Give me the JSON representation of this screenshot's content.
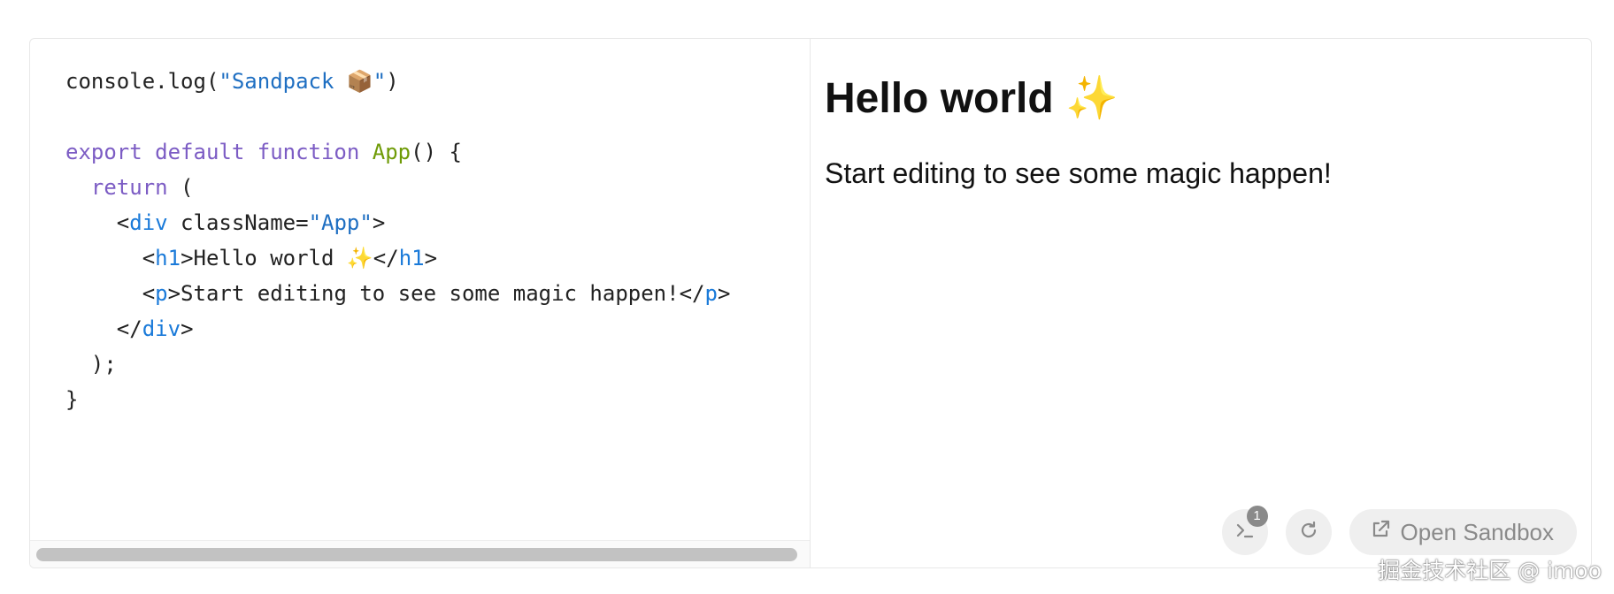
{
  "editor": {
    "lines": {
      "l1": {
        "a": "console.log(",
        "b": "\"Sandpack ",
        "emoji": "📦",
        "c": "\"",
        "d": ")"
      },
      "l3": {
        "a": "export default function ",
        "b": "App",
        "c": "() {"
      },
      "l4": {
        "a": "return",
        "b": " ("
      },
      "l5": {
        "a": "<",
        "b": "div",
        "c": " className=",
        "d": "\"App\"",
        "e": ">"
      },
      "l6": {
        "a": "<",
        "b": "h1",
        "c": ">Hello world ",
        "emoji": "✨",
        "d": "</",
        "e": "h1",
        "f": ">"
      },
      "l7": {
        "a": "<",
        "b": "p",
        "c": ">Start editing to see some magic happen!</",
        "d": "p",
        "e": ">"
      },
      "l8": {
        "a": "</",
        "b": "div",
        "c": ">"
      },
      "l9": {
        "a": ");"
      },
      "l10": {
        "a": "}"
      }
    }
  },
  "preview": {
    "heading": "Hello world",
    "heading_emoji": "✨",
    "paragraph": "Start editing to see some magic happen!"
  },
  "controls": {
    "console_badge": "1",
    "open_label": "Open Sandbox",
    "icons": {
      "console": "terminal-icon",
      "refresh": "refresh-icon",
      "open": "external-link-icon"
    }
  },
  "watermark": "掘金技术社区 @ imoo",
  "colors": {
    "string": "#1f6fc2",
    "keyword": "#7c5cc4",
    "function": "#6f9b07",
    "tag": "#1a7ad9",
    "control_bg": "#efefef",
    "control_fg": "#8a8a8a"
  }
}
